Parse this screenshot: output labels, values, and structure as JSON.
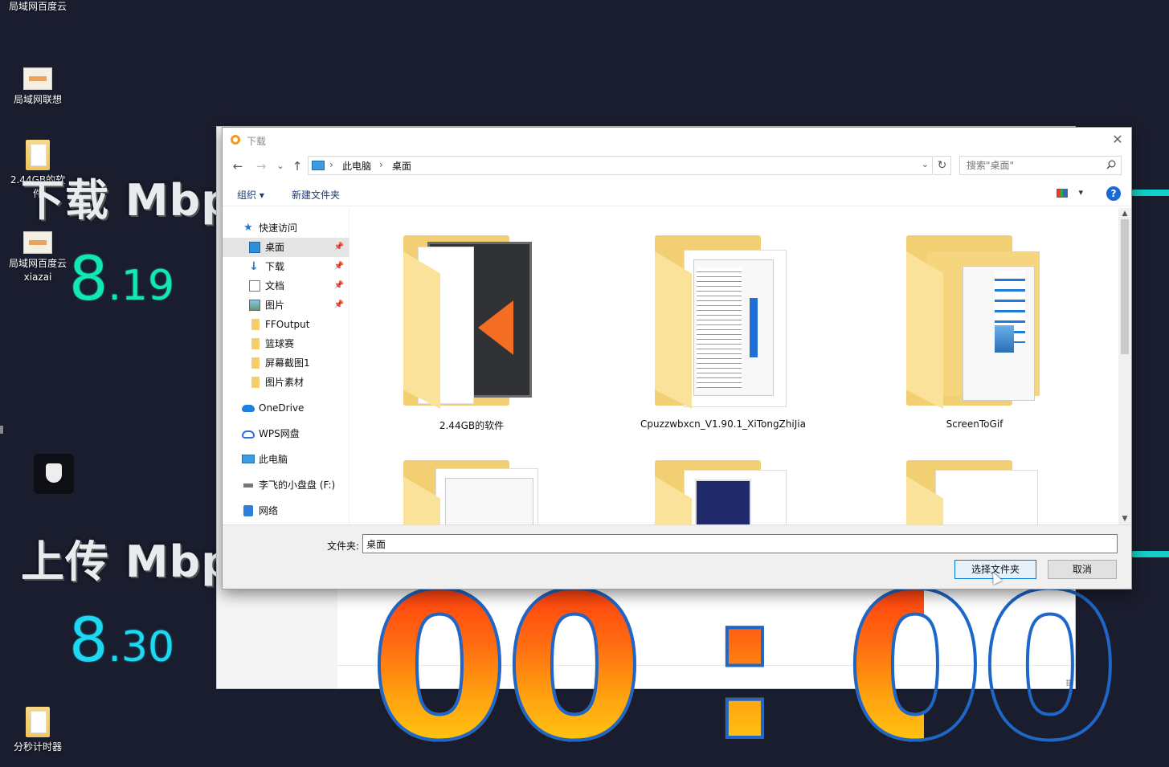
{
  "desktop": {
    "icons": [
      {
        "label": "局域网百度云"
      },
      {
        "label": "局域网联想"
      },
      {
        "label": "2.44GB的软件"
      },
      {
        "label": "局域网百度云xiazai"
      },
      {
        "label": "分秒计时器"
      }
    ],
    "download_label": "下载 Mbp",
    "download_value_int": "8",
    "download_value_dec": ".19",
    "upload_label": "上传 Mbp",
    "upload_value_int": "8",
    "upload_value_dec": ".30",
    "timer": "00 : 00"
  },
  "dialog": {
    "title": "下载",
    "close_glyph": "✕",
    "nav": {
      "back": "←",
      "forward": "→",
      "recent": "⌄",
      "up": "↑"
    },
    "address": {
      "crumbs": [
        "此电脑",
        "桌面"
      ],
      "separator": "›",
      "dropdown": "⌄",
      "refresh": "↻"
    },
    "search_placeholder": "搜索\"桌面\"",
    "toolbar": {
      "organize": "组织 ▾",
      "new_folder": "新建文件夹",
      "view_arrow": "▾",
      "help": "?"
    },
    "nav_pane": {
      "quick_access": "快速访问",
      "items": [
        "桌面",
        "下载",
        "文档",
        "图片",
        "FFOutput",
        "篮球赛",
        "屏幕截图1",
        "图片素材"
      ],
      "onedrive": "OneDrive",
      "wps": "WPS网盘",
      "this_pc": "此电脑",
      "drive": "李飞的小盘盘 (F:)",
      "network": "网络",
      "pin": "📌"
    },
    "files": [
      {
        "name": "2.44GB的软件"
      },
      {
        "name": "Cpuzzwbxcn_V1.90.1_XiTongZhiJia"
      },
      {
        "name": "ScreenToGif"
      }
    ],
    "scroll": {
      "up": "▲",
      "down": "▼"
    },
    "footer": {
      "folder_label": "文件夹:",
      "folder_value": "桌面",
      "select_button": "选择文件夹",
      "cancel_button": "取消"
    }
  },
  "colors": {
    "accent": "#0078d7",
    "timer_stroke": "#1e66c8",
    "download": "#14e6b4",
    "upload": "#1fd8f0"
  }
}
